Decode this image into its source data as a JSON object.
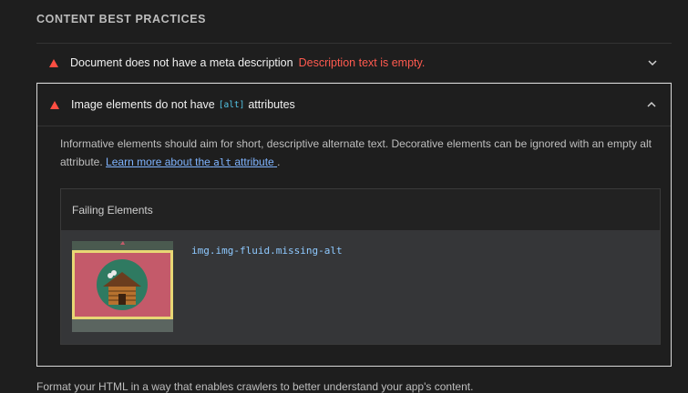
{
  "section": {
    "title": "CONTENT BEST PRACTICES"
  },
  "audits": [
    {
      "title": "Document does not have a meta description",
      "description": "Description text is empty.",
      "state": "collapsed",
      "status_icon": "warning-triangle-icon",
      "toggle_icon": "chevron-down-icon"
    },
    {
      "title_before": "Image elements do not have",
      "title_code": "[alt]",
      "title_after": "attributes",
      "state": "expanded",
      "status_icon": "warning-triangle-icon",
      "toggle_icon": "chevron-up-icon",
      "explanation": "Informative elements should aim for short, descriptive alternate text. Decorative elements can be ignored with an empty alt attribute.",
      "learn_more_prefix": "Learn more about the",
      "learn_more_code": "alt",
      "learn_more_suffix": "attribute",
      "failing": {
        "header": "Failing Elements",
        "items": [
          {
            "selector": "img.img-fluid.missing-alt",
            "thumbnail_icon": "log-cabin-image"
          }
        ]
      }
    }
  ],
  "footer": {
    "text": "Format your HTML in a way that enables crawlers to better understand your app's content."
  },
  "colors": {
    "background": "#1e1e1e",
    "warning": "#ff4e42",
    "link": "#7fb4ff",
    "code": "#54c7e8"
  }
}
